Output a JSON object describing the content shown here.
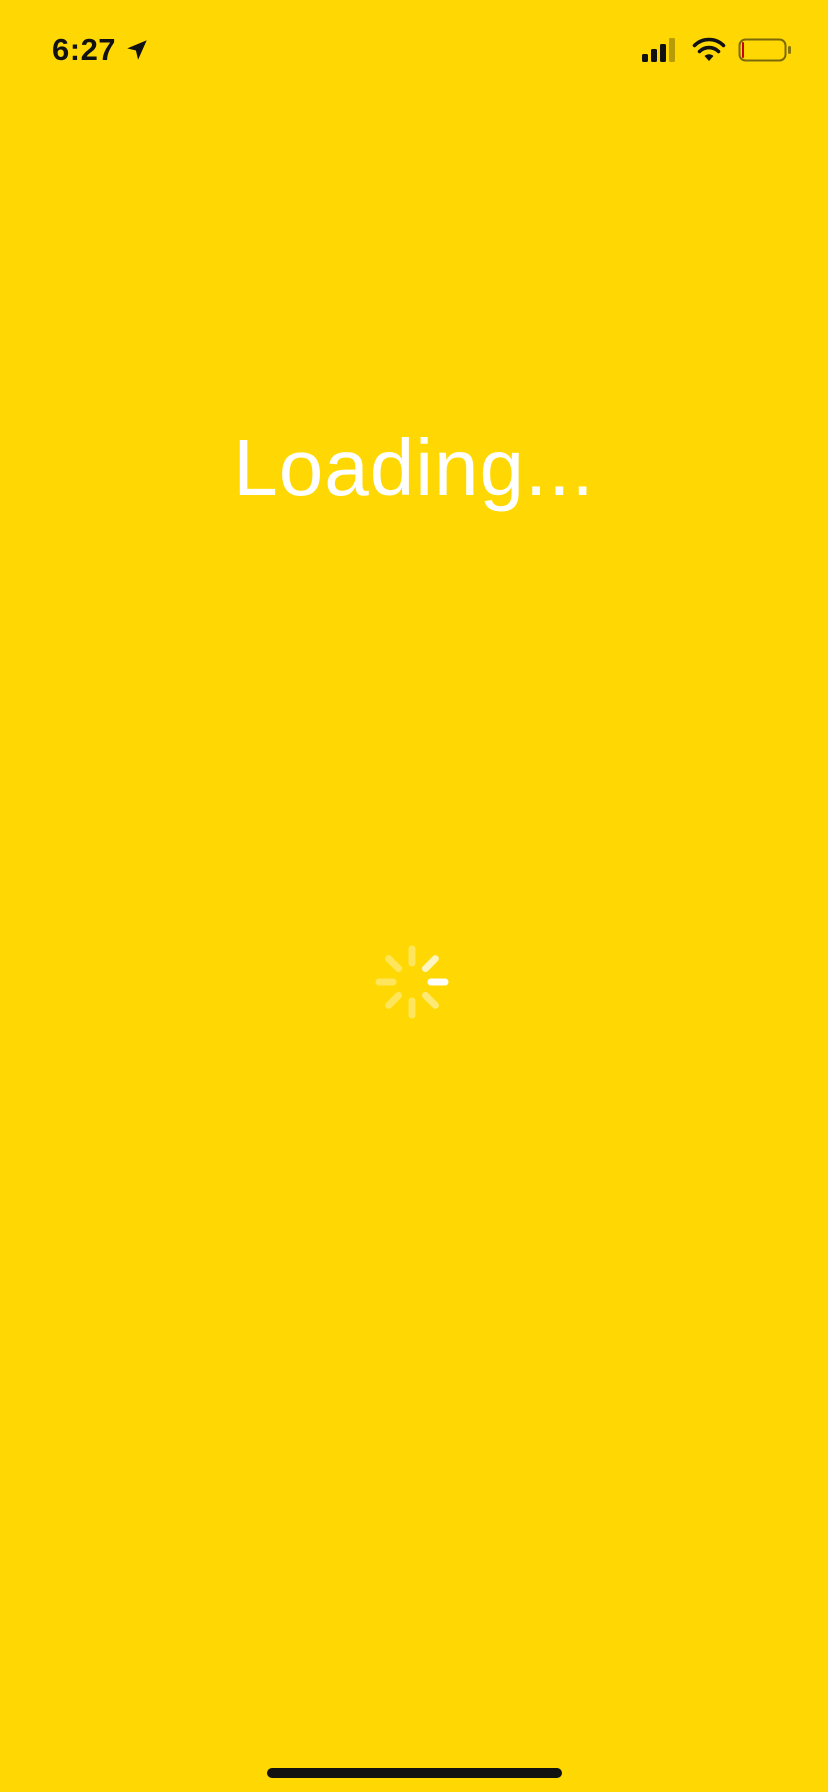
{
  "status_bar": {
    "time": "6:27",
    "location_icon": "location-arrow-icon",
    "signal_icon": "cellular-signal-icon",
    "wifi_icon": "wifi-icon",
    "battery_icon": "battery-icon"
  },
  "main": {
    "loading_text": "Loading...",
    "spinner_icon": "activity-spinner-icon"
  },
  "colors": {
    "background": "#FFD803",
    "text": "#FFFFFF",
    "status_text": "#111111"
  }
}
